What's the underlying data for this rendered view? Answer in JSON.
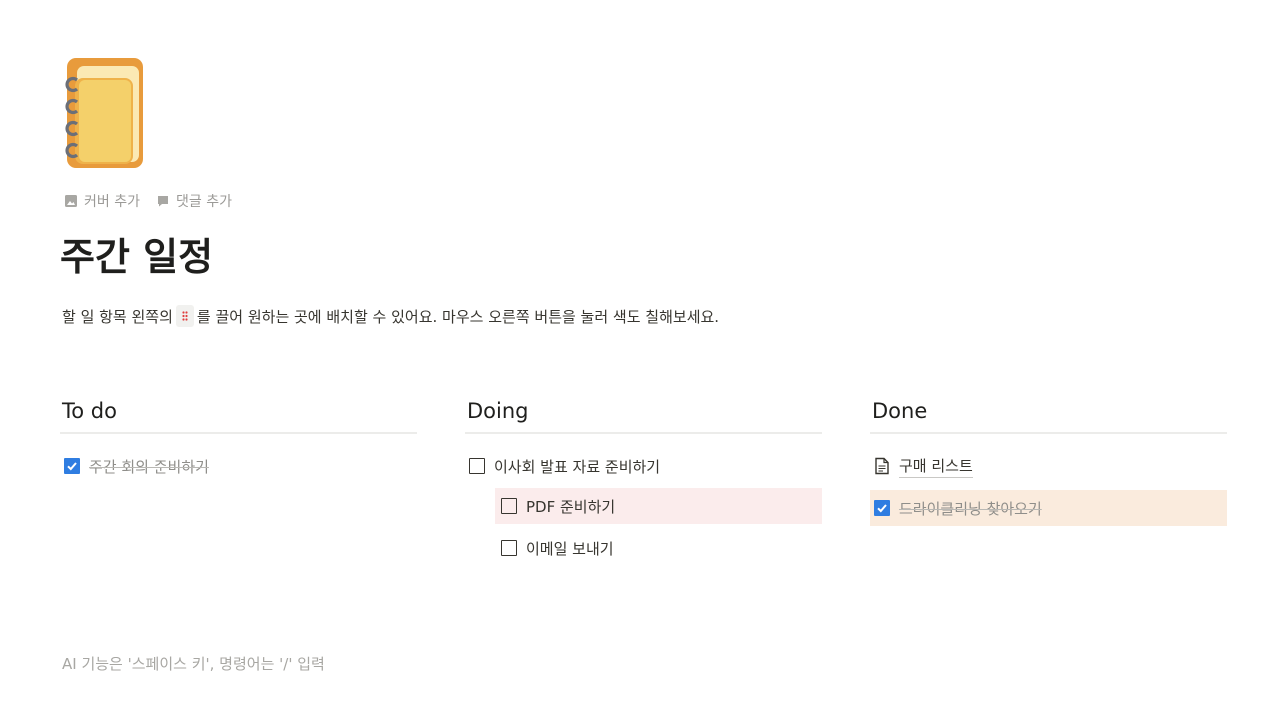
{
  "page": {
    "meta": {
      "add_cover": "커버 추가",
      "add_comment": "댓글 추가"
    },
    "title": "주간 일정",
    "description_before": "할 일 항목 왼쪽의",
    "description_after": "를 끌어 원하는 곳에 배치할 수 있어요. 마우스 오른쪽 버튼을 눌러 색도 칠해보세요.",
    "footer_hint": "AI 기능은 '스페이스 키', 명령어는 '/' 입력"
  },
  "columns": [
    {
      "title": "To do",
      "items": [
        {
          "label": "주간 회의 준비하기",
          "checked": true
        }
      ]
    },
    {
      "title": "Doing",
      "items": [
        {
          "label": "이사회 발표 자료 준비하기",
          "checked": false
        },
        {
          "label": "PDF 준비하기",
          "checked": false,
          "indent": true,
          "highlight": "#fbecec"
        },
        {
          "label": "이메일 보내기",
          "checked": false,
          "indent": true
        }
      ]
    },
    {
      "title": "Done",
      "items": [
        {
          "label": "구매 리스트",
          "type": "page-link",
          "icon": "page-icon"
        },
        {
          "label": "드라이클리닝 찾아오기",
          "checked": true,
          "highlight": "#faebdd"
        }
      ]
    }
  ],
  "colors": {
    "checkbox_checked": "#2f7de1",
    "text_primary": "#37352f",
    "text_muted": "#9b9a97"
  }
}
